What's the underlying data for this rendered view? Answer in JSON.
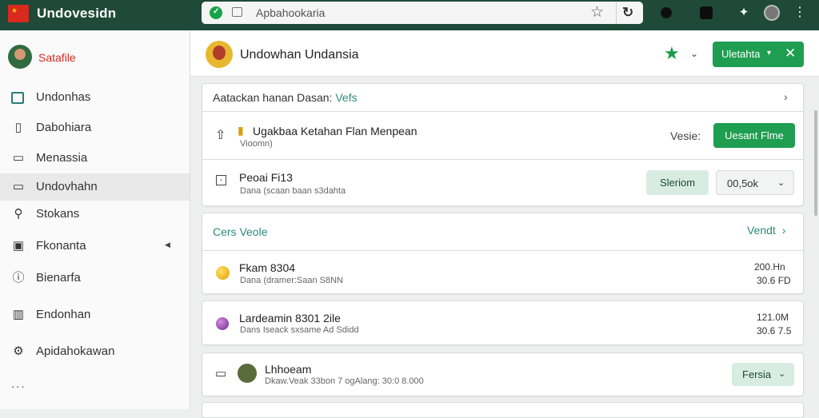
{
  "topbar": {
    "app_title": "Undovesidn",
    "url": "Apbahookaria",
    "icons": [
      "flag-icon",
      "shield-check-icon",
      "tab-icon",
      "star-icon",
      "reload-icon",
      "extension-icon",
      "cast-icon",
      "puzzle-icon",
      "profile-icon",
      "menu-icon"
    ]
  },
  "sidebar": {
    "profile_name": "Satafile",
    "items": [
      {
        "label": "Undonhas",
        "icon": "dashboard-icon"
      },
      {
        "label": "Dabohiara",
        "icon": "document-icon"
      },
      {
        "label": "Menassia",
        "icon": "chat-icon"
      },
      {
        "label": "Undovhahn",
        "icon": "folder-icon",
        "active": true
      },
      {
        "label": "Stokans",
        "icon": "search-icon"
      },
      {
        "label": "Fkonanta",
        "icon": "window-icon"
      },
      {
        "label": "Bienarfa",
        "icon": "info-icon"
      },
      {
        "label": "Endonhan",
        "icon": "columns-icon"
      },
      {
        "label": "Apidahokawan",
        "icon": "settings-icon"
      }
    ],
    "more": "..."
  },
  "header": {
    "title": "Undowhan Undansia",
    "button_label": "Uletahta"
  },
  "section1": {
    "title_prefix": "Aatackan hanan Dasan:",
    "title_link": "Vefs",
    "row1": {
      "title": "Ugakbaa Ketahan Flan Menpean",
      "sub": "Vioomn)",
      "meta": "Vesie:",
      "button": "Uesant Flme"
    },
    "row2": {
      "title": "Peoai Fi13",
      "sub": "Dana (scaan baan s3dahta",
      "button_primary": "Sleriom",
      "select_value": "00,5ok"
    }
  },
  "section2": {
    "title": "Cers Veole",
    "link": "Vendt",
    "row1": {
      "title": "Fkam 8304",
      "sub": "Dana (dramer:Saan S8NN",
      "meta1": "200.Hn",
      "meta2": "30.6 FD"
    },
    "row2": {
      "title": "Lardeamin 8301 2ile",
      "sub": "Dans Iseack sxsame Ad Sdidd",
      "meta1": "121.0M",
      "meta2": "30.6 7.5"
    },
    "row3": {
      "title": "Lhhoeam",
      "sub": "Dkaw.Veak 33bon 7 ogAlang: 30:0 8.000",
      "button": "Fersia"
    }
  },
  "colors": {
    "brand_dark": "#1f4a3a",
    "accent": "#1f9d50",
    "profile_name": "#d52a24",
    "link": "#1f9d50"
  }
}
